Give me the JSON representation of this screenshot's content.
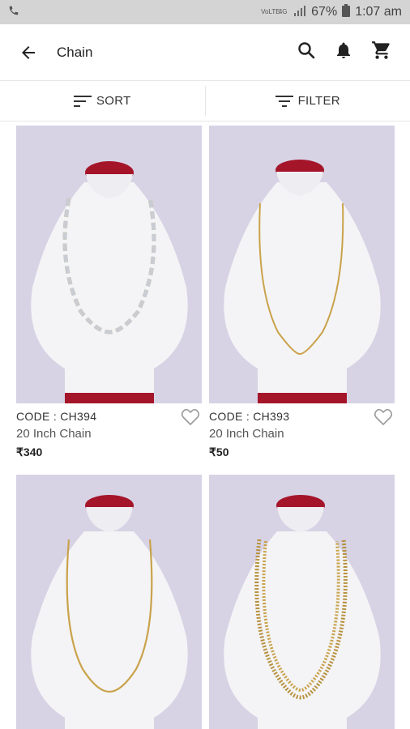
{
  "status_bar": {
    "vo_lte": "VoLTE",
    "network": "4G",
    "battery": "67%",
    "time": "1:07 am"
  },
  "header": {
    "title": "Chain"
  },
  "toolbar": {
    "sort_label": "SORT",
    "filter_label": "FILTER"
  },
  "products": [
    {
      "code": "CODE : CH394",
      "name": "20 Inch Chain",
      "price": "₹340",
      "chain_style": "two-tone link"
    },
    {
      "code": "CODE : CH393",
      "name": "20 Inch Chain",
      "price": "₹50",
      "chain_style": "thin gold"
    },
    {
      "code": "",
      "name": "",
      "price": "",
      "chain_style": "thin gold"
    },
    {
      "code": "",
      "name": "",
      "price": "",
      "chain_style": "rope gold"
    }
  ],
  "colors": {
    "status_bar_bg": "#d4d4d4",
    "image_bg": "#d7d3e5",
    "bust_top": "#a5152a",
    "gold": "#c9a24a",
    "silver": "#c9ccd2"
  }
}
